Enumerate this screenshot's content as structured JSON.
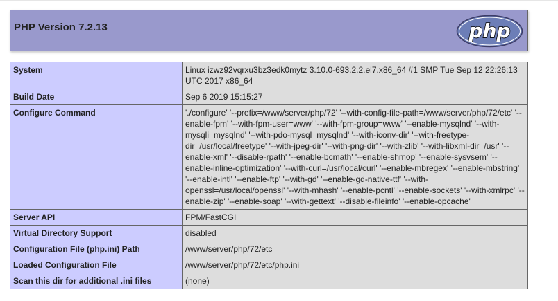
{
  "header": {
    "title": "PHP Version 7.2.13",
    "logo_text": "php"
  },
  "rows": [
    {
      "key": "System",
      "value": "Linux izwz92vqrxu3bz3edk0mytz 3.10.0-693.2.2.el7.x86_64 #1 SMP Tue Sep 12 22:26:13 UTC 2017 x86_64"
    },
    {
      "key": "Build Date",
      "value": "Sep 6 2019 15:15:27"
    },
    {
      "key": "Configure Command",
      "value": "'./configure' '--prefix=/www/server/php/72' '--with-config-file-path=/www/server/php/72/etc' '--enable-fpm' '--with-fpm-user=www' '--with-fpm-group=www' '--enable-mysqlnd' '--with-mysqli=mysqlnd' '--with-pdo-mysql=mysqlnd' '--with-iconv-dir' '--with-freetype-dir=/usr/local/freetype' '--with-jpeg-dir' '--with-png-dir' '--with-zlib' '--with-libxml-dir=/usr' '--enable-xml' '--disable-rpath' '--enable-bcmath' '--enable-shmop' '--enable-sysvsem' '--enable-inline-optimization' '--with-curl=/usr/local/curl' '--enable-mbregex' '--enable-mbstring' '--enable-intl' '--enable-ftp' '--with-gd' '--enable-gd-native-ttf' '--with-openssl=/usr/local/openssl' '--with-mhash' '--enable-pcntl' '--enable-sockets' '--with-xmlrpc' '--enable-zip' '--enable-soap' '--with-gettext' '--disable-fileinfo' '--enable-opcache'"
    },
    {
      "key": "Server API",
      "value": "FPM/FastCGI"
    },
    {
      "key": "Virtual Directory Support",
      "value": "disabled"
    },
    {
      "key": "Configuration File (php.ini) Path",
      "value": "/www/server/php/72/etc"
    },
    {
      "key": "Loaded Configuration File",
      "value": "/www/server/php/72/etc/php.ini"
    },
    {
      "key": "Scan this dir for additional .ini files",
      "value": "(none)"
    }
  ],
  "colors": {
    "header_bg": "#9999cc",
    "key_bg": "#ccccff",
    "value_bg": "#dddddd"
  }
}
